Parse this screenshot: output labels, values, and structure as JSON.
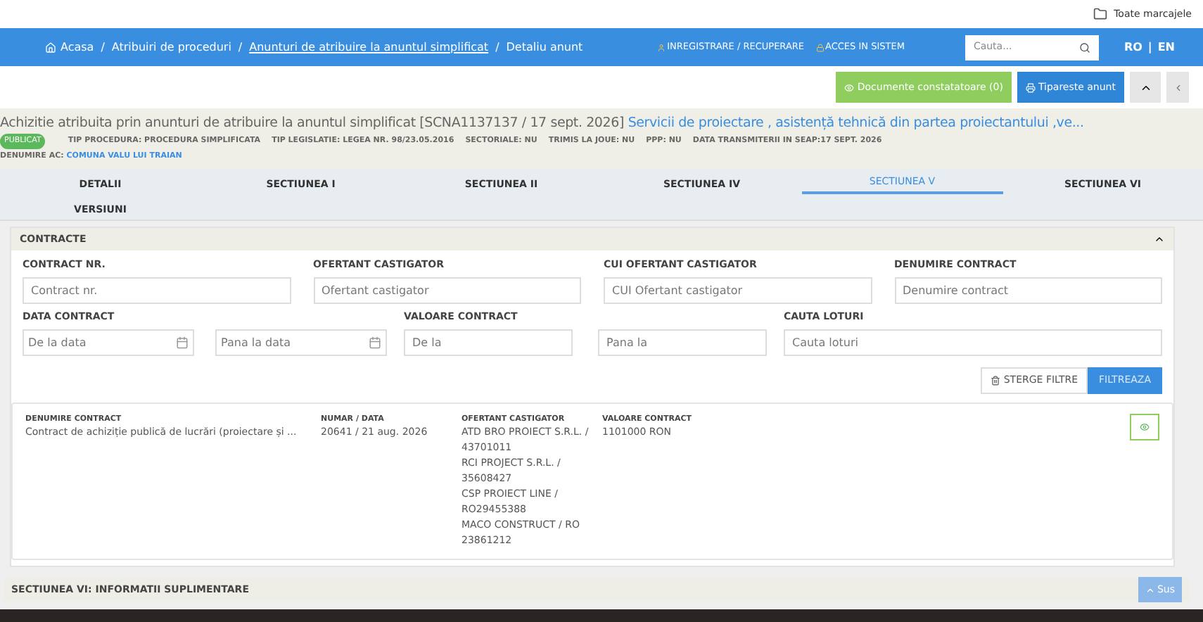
{
  "bookmarks": {
    "label": "Toate marcajele"
  },
  "breadcrumb": [
    {
      "label": "Acasa",
      "link": false
    },
    {
      "separator": "/",
      "label": "Atribuiri de proceduri",
      "link": false
    },
    {
      "separator": "/",
      "label": "Anunturi de atribuire la anuntul simplificat",
      "link": true
    },
    {
      "separator": "/",
      "label": "Detaliu anunt",
      "link": false
    }
  ],
  "nav_links": [
    "INREGISTRARE / RECUPERARE",
    "ACCES IN SISTEM"
  ],
  "search": {
    "placeholder": "Cauta..."
  },
  "languages": {
    "items": [
      "RO",
      "EN"
    ],
    "separator": "|"
  },
  "actions": {
    "documents": "Documente constatatoare (0)",
    "print": "Tipareste anunt"
  },
  "notice": {
    "title": "Achizitie atribuita prin anunturi de atribuire la anuntul simplificat [SCNA1137137 / 17 sept. 2026]",
    "subject": "Servicii de proiectare , asistență tehnică din partea proiectantului ,ve...",
    "status": "PUBLICAT",
    "meta": [
      "TIP PROCEDURA: PROCEDURA SIMPLIFICATA",
      "TIP LEGISLATIE: LEGEA NR. 98/23.05.2016",
      "SECTORIALE: NU",
      "TRIMIS LA JOUE: NU",
      "PPP: NU",
      "DATA TRANSMITERII IN SEAP:17 SEPT. 2026"
    ],
    "authority_label": "DENUMIRE AC:",
    "authority": "COMUNA VALU LUI TRAIAN"
  },
  "tabs": [
    {
      "label": "DETALII",
      "selected": false
    },
    {
      "label": "SECTIUNEA I",
      "selected": false
    },
    {
      "label": "SECTIUNEA II",
      "selected": false
    },
    {
      "label": "SECTIUNEA IV",
      "selected": false
    },
    {
      "label": "SECTIUNEA V",
      "selected": true
    },
    {
      "label": "SECTIUNEA VI",
      "selected": false
    },
    {
      "label": "VERSIUNI",
      "selected": false
    }
  ],
  "panel": {
    "title": "CONTRACTE",
    "expanded": true,
    "filters_row1": [
      {
        "label": "CONTRACT NR.",
        "placeholder": "Contract nr."
      },
      {
        "label": "OFERTANT CASTIGATOR",
        "placeholder": "Ofertant castigator"
      },
      {
        "label": "CUI OFERTANT CASTIGATOR",
        "placeholder": "CUI Ofertant castigator"
      },
      {
        "label": "DENUMIRE CONTRACT",
        "placeholder": "Denumire contract"
      }
    ],
    "date_filter": {
      "label": "DATA CONTRACT",
      "from": "De la data",
      "to": "Pana la data"
    },
    "value_filter": {
      "label": "VALOARE CONTRACT",
      "from_placeholder": "De la",
      "to_placeholder": "Pana la"
    },
    "lots_filter": {
      "label": "CAUTA LOTURI",
      "placeholder": "Cauta loturi"
    },
    "clear_button": "STERGE FILTRE",
    "filter_button": "FILTREAZA",
    "columns": [
      "DENUMIRE CONTRACT",
      "NUMAR / DATA",
      "OFERTANT CASTIGATOR",
      "VALOARE CONTRACT"
    ],
    "rows": [
      {
        "name": "Contract de achiziție publică de lucrări (proiectare și ...",
        "number_date": "20641 / 21 aug. 2026",
        "bidders": [
          "ATD BRO PROIECT S.R.L. / 43701011",
          "RCI PROJECT S.R.L. / 35608427",
          "CSP PROIECT LINE / RO29455388",
          "MACO CONSTRUCT / RO 23861212"
        ],
        "value": "1101000 RON"
      }
    ]
  },
  "next_section": {
    "title": "SECTIUNEA VI: INFORMATII SUPLIMENTARE"
  },
  "back_to_top": "Sus"
}
